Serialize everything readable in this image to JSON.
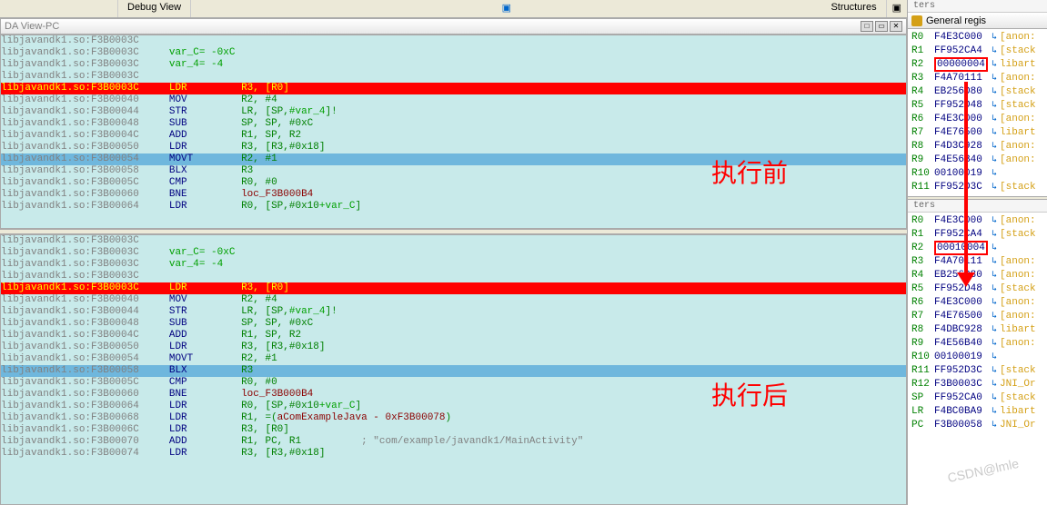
{
  "top": {
    "view_name": "Debug View",
    "structures": "Structures",
    "ters": "ters"
  },
  "titlebar": {
    "title": "DA View-PC"
  },
  "reg_title": "General regis",
  "overlay": {
    "before": "执行前",
    "after": "执行后"
  },
  "watermark": "CSDN@lmle",
  "pane1": {
    "lines": [
      {
        "cls": "",
        "addr": "libjavandk1.so:F3B0003C",
        "m": "",
        "ops": ""
      },
      {
        "cls": "",
        "addr": "libjavandk1.so:F3B0003C",
        "m": "",
        "ops": "",
        "var": "var_C= -0xC"
      },
      {
        "cls": "",
        "addr": "libjavandk1.so:F3B0003C",
        "m": "",
        "ops": "",
        "var": "var_4= -4"
      },
      {
        "cls": "",
        "addr": "libjavandk1.so:F3B0003C",
        "m": "",
        "ops": ""
      },
      {
        "cls": "red",
        "addr": "libjavandk1.so:F3B0003C",
        "m": "LDR",
        "ops": "R3, [R0]"
      },
      {
        "cls": "",
        "addr": "libjavandk1.so:F3B00040",
        "m": "MOV",
        "ops": "R2, ",
        "tail": "#4"
      },
      {
        "cls": "",
        "addr": "libjavandk1.so:F3B00044",
        "m": "STR",
        "ops": "LR, [SP,",
        "tail2": "#var_4",
        "tail3": "]!"
      },
      {
        "cls": "",
        "addr": "libjavandk1.so:F3B00048",
        "m": "SUB",
        "ops": "SP, SP, ",
        "tail": "#0xC"
      },
      {
        "cls": "",
        "addr": "libjavandk1.so:F3B0004C",
        "m": "ADD",
        "ops": "R1, SP, R2"
      },
      {
        "cls": "",
        "addr": "libjavandk1.so:F3B00050",
        "m": "LDR",
        "ops": "R3, [R3,",
        "tail": "#0x18",
        "tail3": "]"
      },
      {
        "cls": "blue",
        "addr": "libjavandk1.so:F3B00054",
        "m": "MOVT",
        "ops": "R2, ",
        "tail": "#1"
      },
      {
        "cls": "",
        "addr": "libjavandk1.so:F3B00058",
        "m": "BLX",
        "ops": "R3"
      },
      {
        "cls": "",
        "addr": "libjavandk1.so:F3B0005C",
        "m": "CMP",
        "ops": "R0, ",
        "tail": "#0"
      },
      {
        "cls": "",
        "addr": "libjavandk1.so:F3B00060",
        "m": "BNE",
        "loc": "loc_F3B000B4"
      },
      {
        "cls": "",
        "addr": "libjavandk1.so:F3B00064",
        "m": "LDR",
        "ops": "R0, [SP,",
        "tail": "#0x10",
        "tail2b": "+var_C",
        "tail3": "]"
      }
    ]
  },
  "pane2": {
    "lines": [
      {
        "cls": "",
        "addr": "libjavandk1.so:F3B0003C",
        "m": "",
        "ops": ""
      },
      {
        "cls": "",
        "addr": "libjavandk1.so:F3B0003C",
        "m": "",
        "ops": "",
        "var": "var_C= -0xC"
      },
      {
        "cls": "",
        "addr": "libjavandk1.so:F3B0003C",
        "m": "",
        "ops": "",
        "var": "var_4= -4"
      },
      {
        "cls": "",
        "addr": "libjavandk1.so:F3B0003C",
        "m": "",
        "ops": ""
      },
      {
        "cls": "red",
        "addr": "libjavandk1.so:F3B0003C",
        "m": "LDR",
        "ops": "R3, [R0]"
      },
      {
        "cls": "",
        "addr": "libjavandk1.so:F3B00040",
        "m": "MOV",
        "ops": "R2, ",
        "tail": "#4"
      },
      {
        "cls": "",
        "addr": "libjavandk1.so:F3B00044",
        "m": "STR",
        "ops": "LR, [SP,",
        "tail2": "#var_4",
        "tail3": "]!"
      },
      {
        "cls": "",
        "addr": "libjavandk1.so:F3B00048",
        "m": "SUB",
        "ops": "SP, SP, ",
        "tail": "#0xC"
      },
      {
        "cls": "",
        "addr": "libjavandk1.so:F3B0004C",
        "m": "ADD",
        "ops": "R1, SP, R2"
      },
      {
        "cls": "",
        "addr": "libjavandk1.so:F3B00050",
        "m": "LDR",
        "ops": "R3, [R3,",
        "tail": "#0x18",
        "tail3": "]"
      },
      {
        "cls": "",
        "addr": "libjavandk1.so:F3B00054",
        "m": "MOVT",
        "ops": "R2, ",
        "tail": "#1"
      },
      {
        "cls": "blue",
        "addr": "libjavandk1.so:F3B00058",
        "m": "BLX",
        "ops": "R3"
      },
      {
        "cls": "",
        "addr": "libjavandk1.so:F3B0005C",
        "m": "CMP",
        "ops": "R0, ",
        "tail": "#0"
      },
      {
        "cls": "",
        "addr": "libjavandk1.so:F3B00060",
        "m": "BNE",
        "loc": "loc_F3B000B4"
      },
      {
        "cls": "",
        "addr": "libjavandk1.so:F3B00064",
        "m": "LDR",
        "ops": "R0, [SP,",
        "tail": "#0x10",
        "tail2b": "+var_C",
        "tail3": "]"
      },
      {
        "cls": "",
        "addr": "libjavandk1.so:F3B00068",
        "m": "LDR",
        "ops": "R1, =(",
        "tail4": "aComExampleJava - 0xF3B00078",
        "tail3": ")"
      },
      {
        "cls": "",
        "addr": "libjavandk1.so:F3B0006C",
        "m": "LDR",
        "ops": "R3, [R0]"
      },
      {
        "cls": "",
        "addr": "libjavandk1.so:F3B00070",
        "m": "ADD",
        "ops": "R1, PC, R1",
        "comment": "; \"com/example/javandk1/MainActivity\""
      },
      {
        "cls": "",
        "addr": "libjavandk1.so:F3B00074",
        "m": "LDR",
        "ops": "R3, [R3,",
        "tail": "#0x18",
        "tail3": "]"
      }
    ]
  },
  "regs1": [
    {
      "n": "R0",
      "v": "F4E3C000",
      "t": "[anon:"
    },
    {
      "n": "R1",
      "v": "FF952CA4",
      "t": "[stack"
    },
    {
      "n": "R2",
      "v": "00000004",
      "t": "libart",
      "box": true
    },
    {
      "n": "R3",
      "v": "F4A70111",
      "t": "[anon:"
    },
    {
      "n": "R4",
      "v": "EB256D80",
      "t": "[stack"
    },
    {
      "n": "R5",
      "v": "FF952D48",
      "t": "[stack"
    },
    {
      "n": "R6",
      "v": "F4E3C000",
      "t": "[anon:"
    },
    {
      "n": "R7",
      "v": "F4E76500",
      "t": "libart"
    },
    {
      "n": "R8",
      "v": "F4D3C928",
      "t": "[anon:"
    },
    {
      "n": "R9",
      "v": "F4E56B40",
      "t": "[anon:"
    },
    {
      "n": "R10",
      "v": "00100019",
      "t": ""
    },
    {
      "n": "R11",
      "v": "FF952D3C",
      "t": "[stack"
    }
  ],
  "regs2": [
    {
      "n": "R0",
      "v": "F4E3C000",
      "t": "[anon:"
    },
    {
      "n": "R1",
      "v": "FF952CA4",
      "t": "[stack"
    },
    {
      "n": "R2",
      "v": "00010004",
      "t": "",
      "box": true
    },
    {
      "n": "R3",
      "v": "F4A70111",
      "t": "[anon:"
    },
    {
      "n": "R4",
      "v": "EB256D80",
      "t": "[anon:"
    },
    {
      "n": "R5",
      "v": "FF952D48",
      "t": "[stack"
    },
    {
      "n": "R6",
      "v": "F4E3C000",
      "t": "[anon:"
    },
    {
      "n": "R7",
      "v": "F4E76500",
      "t": "[anon:"
    },
    {
      "n": "R8",
      "v": "F4DBC928",
      "t": "libart"
    },
    {
      "n": "R9",
      "v": "F4E56B40",
      "t": "[anon:"
    },
    {
      "n": "R10",
      "v": "00100019",
      "t": ""
    },
    {
      "n": "R11",
      "v": "FF952D3C",
      "t": "[stack"
    },
    {
      "n": "R12",
      "v": "F3B0003C",
      "t": "JNI_Or"
    },
    {
      "n": "SP",
      "v": "FF952CA0",
      "t": "[stack"
    },
    {
      "n": "LR",
      "v": "F4BC0BA9",
      "t": "libart"
    },
    {
      "n": "PC",
      "v": "F3B00058",
      "t": "JNI_Or"
    }
  ],
  "ters_tab": "ters"
}
